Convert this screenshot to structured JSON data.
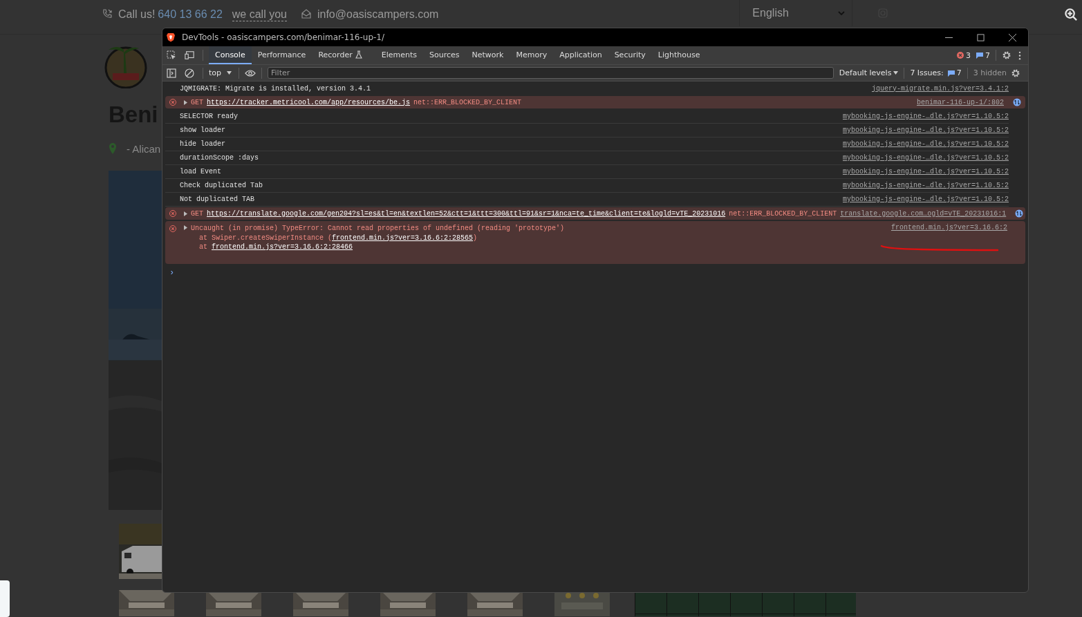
{
  "page": {
    "call_label": "Call us!",
    "phone": "640 13 66 22",
    "callback_link": "we call you",
    "email": "info@oasiscampers.com",
    "language": "English",
    "heading": "Beni",
    "location": "- Alican"
  },
  "devtools": {
    "title": "DevTools - oasiscampers.com/benimar-116-up-1/",
    "tabs": [
      {
        "label": "Console",
        "selected": true
      },
      {
        "label": "Performance",
        "selected": false
      },
      {
        "label": "Recorder",
        "selected": false,
        "experimental": true
      },
      {
        "label": "Elements",
        "selected": false
      },
      {
        "label": "Sources",
        "selected": false
      },
      {
        "label": "Network",
        "selected": false
      },
      {
        "label": "Memory",
        "selected": false
      },
      {
        "label": "Application",
        "selected": false
      },
      {
        "label": "Security",
        "selected": false
      },
      {
        "label": "Lighthouse",
        "selected": false
      }
    ],
    "error_count": "3",
    "message_count": "7",
    "toolbar": {
      "context": "top",
      "filter_placeholder": "Filter",
      "levels": "Default levels",
      "issues_label": "7 Issues:",
      "issues_count": "7",
      "hidden": "3 hidden"
    },
    "messages": [
      {
        "kind": "log",
        "text": "JQMIGRATE: Migrate is installed, version 3.4.1",
        "source": "jquery-migrate.min.js?ver=3.4.1:2"
      },
      {
        "kind": "request_error",
        "method": "GET",
        "url": "https://tracker.metricool.com/app/resources/be.js",
        "error": "net::ERR_BLOCKED_BY_CLIENT",
        "source": "benimar-116-up-1/:802"
      },
      {
        "kind": "log",
        "text": "SELECTOR ready",
        "source": "mybooking-js-engine-…dle.js?ver=1.10.5:2"
      },
      {
        "kind": "log",
        "text": "show loader",
        "source": "mybooking-js-engine-…dle.js?ver=1.10.5:2"
      },
      {
        "kind": "log",
        "text": "hide loader",
        "source": "mybooking-js-engine-…dle.js?ver=1.10.5:2"
      },
      {
        "kind": "log",
        "text": "durationScope :days",
        "source": "mybooking-js-engine-…dle.js?ver=1.10.5:2"
      },
      {
        "kind": "log",
        "text": "load Event",
        "source": "mybooking-js-engine-…dle.js?ver=1.10.5:2"
      },
      {
        "kind": "log",
        "text": "Check duplicated Tab",
        "source": "mybooking-js-engine-…dle.js?ver=1.10.5:2"
      },
      {
        "kind": "log",
        "text": "Not duplicated TAB",
        "source": "mybooking-js-engine-…dle.js?ver=1.10.5:2"
      },
      {
        "kind": "request_error",
        "method": "GET",
        "url": "https://translate.google.com/gen204?sl=es&tl=en&textlen=52&ctt=1&ttt=300&ttl=91&sr=1&nca=te_time&client=te&logld=vTE_20231016",
        "error": "net::ERR_BLOCKED_BY_CLIENT",
        "source": "translate.google.com…ogld=vTE_20231016:1"
      },
      {
        "kind": "exception",
        "text": "Uncaught (in promise) TypeError: Cannot read properties of undefined (reading 'prototype')",
        "stack": [
          {
            "prefix": "at Swiper.createSwiperInstance (",
            "link": "frontend.min.js?ver=3.16.6:2:28565",
            "suffix": ")"
          },
          {
            "prefix": "at ",
            "link": "frontend.min.js?ver=3.16.6:2:28466"
          }
        ],
        "source": "frontend.min.js?ver=3.16.6:2"
      }
    ],
    "prompt": "›"
  }
}
